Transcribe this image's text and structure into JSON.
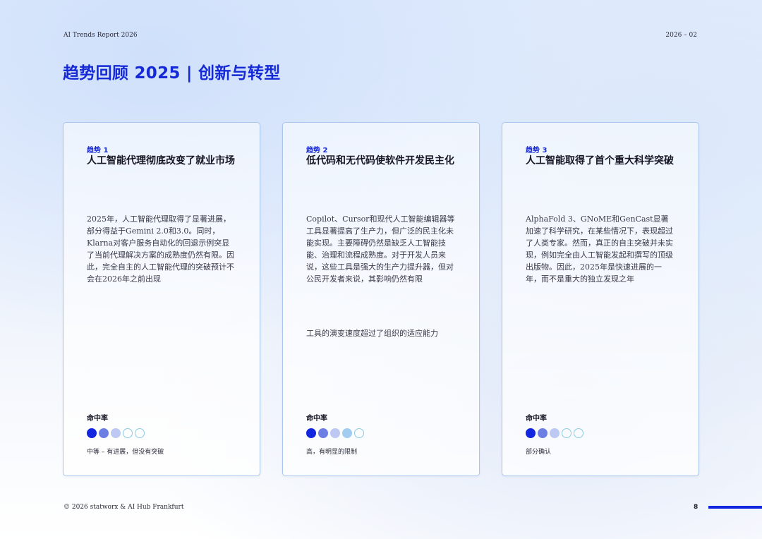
{
  "header": {
    "report_name": "AI Trends Report 2026",
    "page_ref": "2026 – 02"
  },
  "page_title": "趋势回顾 2025 | 创新与转型",
  "colors": {
    "accent_blue": "#1529d6",
    "card_border": "#a9c6ee",
    "dot_outline": "#8ccbe0"
  },
  "cards": [
    {
      "label": "趋势 1",
      "title": "人工智能代理彻底改变了就业市场",
      "body": "2025年，人工智能代理取得了显著进展，部分得益于Gemini 2.0和3.0。同时，Klarna对客户服务自动化的回退示例突显了当前代理解决方案的成熟度仍然有限。因此，完全自主的人工智能代理的突破预计不会在2026年之前出现",
      "extra": "",
      "hit_label": "命中率",
      "hit_levels": [
        "full",
        "2",
        "3",
        "empty",
        "empty"
      ],
      "hit_desc": "中等 – 有进展，但没有突破"
    },
    {
      "label": "趋势 2",
      "title": "低代码和无代码使软件开发民主化",
      "body": "Copilot、Cursor和现代人工智能编辑器等工具显著提高了生产力，但广泛的民主化未能实现。主要障碍仍然是缺乏人工智能技能、治理和流程成熟度。对于开发人员来说，这些工具是强大的生产力提升器，但对公民开发者来说，其影响仍然有限",
      "extra": "工具的演变速度超过了组织的适应能力",
      "hit_label": "命中率",
      "hit_levels": [
        "full",
        "2",
        "3",
        "4",
        "empty"
      ],
      "hit_desc": "高，有明显的限制"
    },
    {
      "label": "趋势 3",
      "title": "人工智能取得了首个重大科学突破",
      "body": "AlphaFold 3、GNoME和GenCast显著加速了科学研究，在某些情况下，表现超过了人类专家。然而，真正的自主突破并未实现，例如完全由人工智能发起和撰写的顶级出版物。因此，2025年是快速进展的一年，而不是重大的独立发现之年",
      "extra": "",
      "hit_label": "命中率",
      "hit_levels": [
        "full",
        "2",
        "3",
        "empty",
        "empty"
      ],
      "hit_desc": "部分确认"
    }
  ],
  "footer": {
    "copyright": "© 2026 statworx & AI Hub Frankfurt",
    "page_number": "8"
  }
}
